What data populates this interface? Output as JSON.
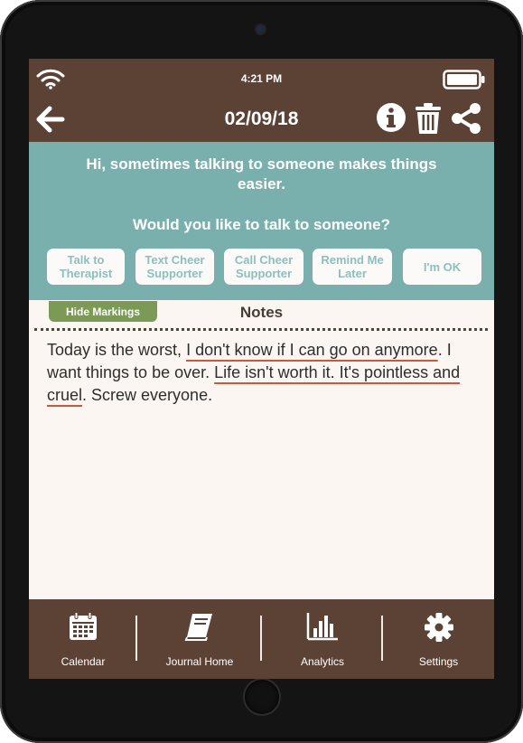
{
  "status_bar": {
    "time": "4:21 PM"
  },
  "header": {
    "date": "02/09/18"
  },
  "prompt": {
    "message": "Hi, sometimes talking to someone makes things easier.",
    "question": "Would you like to talk to someone?",
    "options": [
      {
        "label": "Talk to Therapist"
      },
      {
        "label": "Text Cheer Supporter"
      },
      {
        "label": "Call Cheer Supporter"
      },
      {
        "label": "Remind Me Later"
      },
      {
        "label": "I'm OK"
      }
    ]
  },
  "notes": {
    "hide_markings_label": "Hide Markings",
    "title": "Notes",
    "segments": [
      {
        "text": "Today is the worst, "
      },
      {
        "text": "I don't know if I can go on anymore"
      },
      {
        "text": ". I want things to be over. "
      },
      {
        "text": "Life isn't worth it. It's pointless and cruel"
      },
      {
        "text": ". Screw everyone."
      }
    ],
    "mark_color": "#c75a3e"
  },
  "tabs": [
    {
      "label": "Calendar",
      "icon": "calendar-icon"
    },
    {
      "label": "Journal Home",
      "icon": "book-icon"
    },
    {
      "label": "Analytics",
      "icon": "bar-chart-icon"
    },
    {
      "label": "Settings",
      "icon": "gear-icon"
    }
  ],
  "colors": {
    "bar": "#5c4234",
    "prompt_bg": "#79b0ad",
    "option_text": "#8cc0bc",
    "hide_button": "#7b9a55",
    "page_bg": "#fbf6f2"
  }
}
